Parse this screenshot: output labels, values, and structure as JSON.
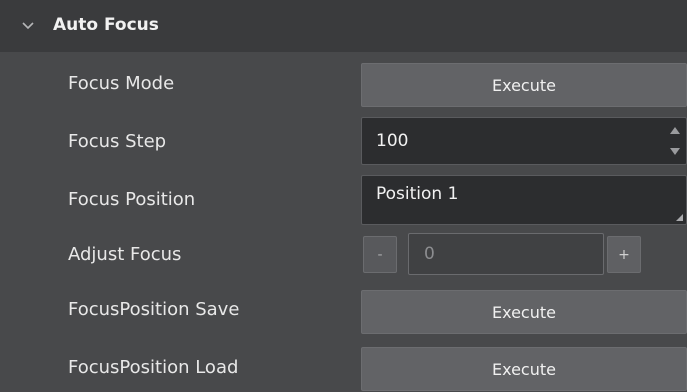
{
  "section": {
    "title": "Auto Focus"
  },
  "rows": {
    "focus_mode": {
      "label": "Focus Mode",
      "button": "Execute"
    },
    "focus_step": {
      "label": "Focus Step",
      "value": "100"
    },
    "focus_position": {
      "label": "Focus Position",
      "value": "Position 1"
    },
    "adjust_focus": {
      "label": "Adjust Focus",
      "minus": "-",
      "value": "0",
      "plus": "+"
    },
    "focus_position_save": {
      "label": "FocusPosition Save",
      "button": "Execute"
    },
    "focus_position_load": {
      "label": "FocusPosition Load",
      "button": "Execute"
    }
  },
  "icons": {
    "collapse": "chevron-down-icon"
  },
  "colors": {
    "background": "#48494b",
    "header": "#3a3b3d",
    "button": "#626366",
    "field": "#2c2d2f"
  }
}
